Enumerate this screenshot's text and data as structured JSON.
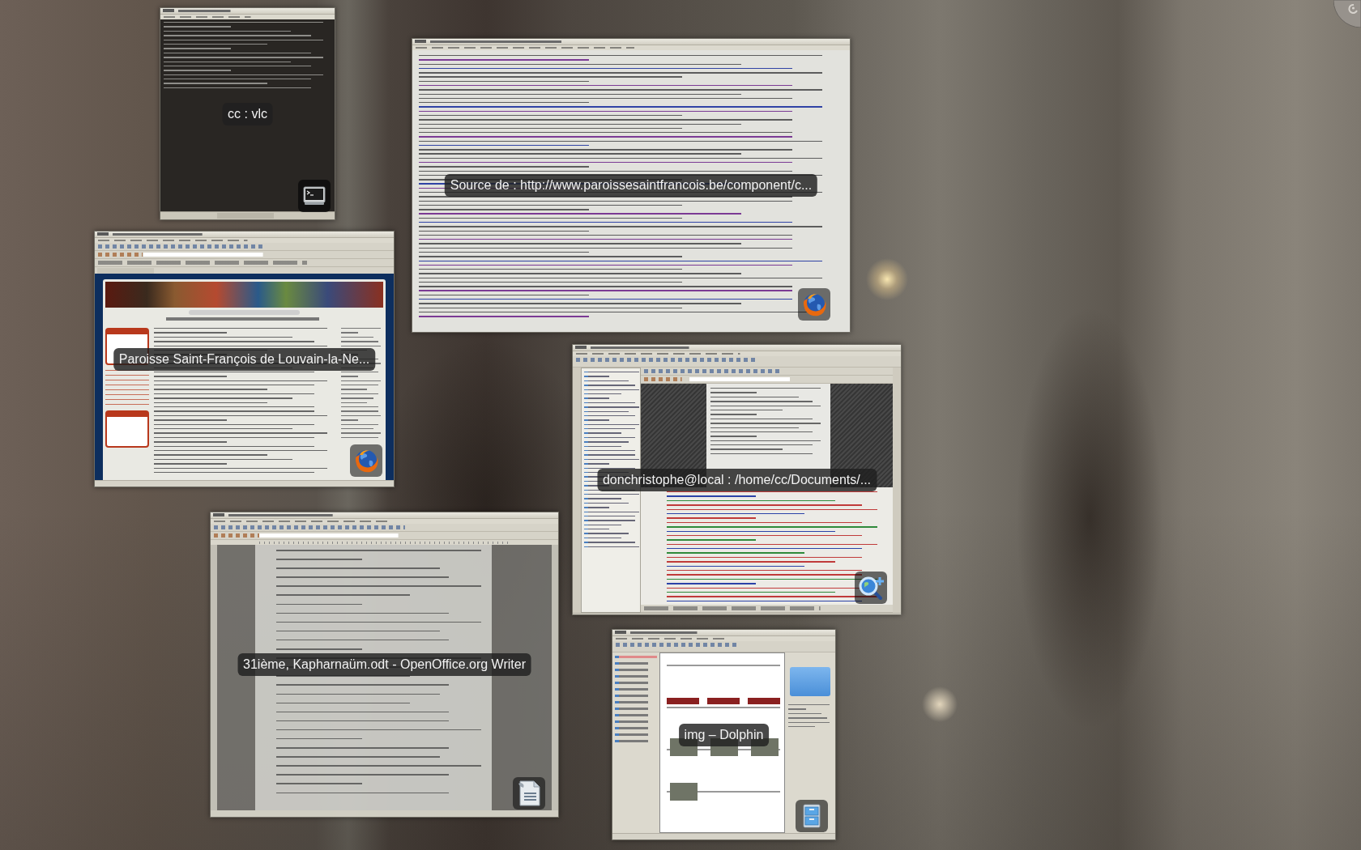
{
  "windows": [
    {
      "kind": "terminal",
      "caption": "cc : vlc"
    },
    {
      "kind": "source-view",
      "caption": "Source de : http://www.paroissesaintfrancois.be/component/c..."
    },
    {
      "kind": "web-page",
      "caption": "Paroisse Saint-François de Louvain-la-Ne..."
    },
    {
      "kind": "web-editor",
      "caption": "donchristophe@local : /home/cc/Documents/..."
    },
    {
      "kind": "document",
      "caption": "31ième, Kapharnaüm.odt - OpenOffice.org Writer"
    },
    {
      "kind": "file-manager",
      "caption": "img – Dolphin"
    }
  ]
}
